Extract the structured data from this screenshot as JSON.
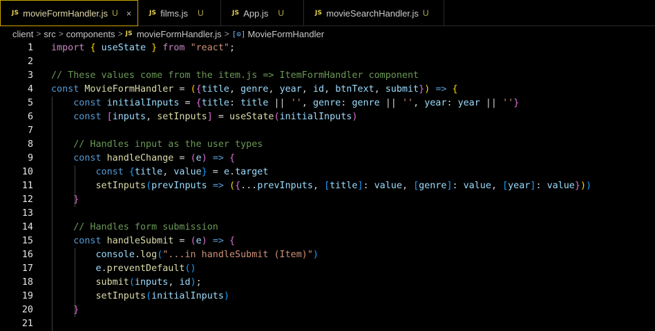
{
  "tabs": [
    {
      "icon": "JS",
      "label": "movieFormHandler.js",
      "status": "U",
      "close": "×",
      "active": true
    },
    {
      "icon": "JS",
      "label": "films.js",
      "status": "U",
      "active": false
    },
    {
      "icon": "JS",
      "label": "App.js",
      "status": "U",
      "active": false
    },
    {
      "icon": "JS",
      "label": "movieSearchHandler.js",
      "status": "U",
      "active": false
    }
  ],
  "breadcrumb": {
    "items": [
      "client",
      "src",
      "components"
    ],
    "file_icon": "JS",
    "file": "movieFormHandler.js",
    "symbol": "MovieFormHandler",
    "sep": ">"
  },
  "editor": {
    "line_numbers": [
      "1",
      "2",
      "3",
      "4",
      "5",
      "6",
      "7",
      "8",
      "9",
      "10",
      "11",
      "12",
      "13",
      "14",
      "15",
      "16",
      "17",
      "18",
      "19",
      "20",
      "21"
    ],
    "lines": [
      [
        [
          "ctl",
          "import"
        ],
        [
          "op",
          " "
        ],
        [
          "b1",
          "{"
        ],
        [
          "op",
          " "
        ],
        [
          "var",
          "useState"
        ],
        [
          "op",
          " "
        ],
        [
          "b1",
          "}"
        ],
        [
          "op",
          " "
        ],
        [
          "ctl",
          "from"
        ],
        [
          "op",
          " "
        ],
        [
          "str",
          "\"react\""
        ],
        [
          "op",
          ";"
        ]
      ],
      [],
      [
        [
          "cmt",
          "// These values come from the item.js => ItemFormHandler component"
        ]
      ],
      [
        [
          "kw",
          "const"
        ],
        [
          "op",
          " "
        ],
        [
          "fn",
          "MovieFormHandler"
        ],
        [
          "op",
          " = "
        ],
        [
          "b1",
          "("
        ],
        [
          "b2",
          "{"
        ],
        [
          "var",
          "title"
        ],
        [
          "op",
          ", "
        ],
        [
          "var",
          "genre"
        ],
        [
          "op",
          ", "
        ],
        [
          "var",
          "year"
        ],
        [
          "op",
          ", "
        ],
        [
          "var",
          "id"
        ],
        [
          "op",
          ", "
        ],
        [
          "var",
          "btnText"
        ],
        [
          "op",
          ", "
        ],
        [
          "var",
          "submit"
        ],
        [
          "b2",
          "}"
        ],
        [
          "b1",
          ")"
        ],
        [
          "op",
          " "
        ],
        [
          "kw",
          "=>"
        ],
        [
          "op",
          " "
        ],
        [
          "b1",
          "{"
        ]
      ],
      [
        [
          "op",
          "    "
        ],
        [
          "kw",
          "const"
        ],
        [
          "op",
          " "
        ],
        [
          "var",
          "initialInputs"
        ],
        [
          "op",
          " = "
        ],
        [
          "b2",
          "{"
        ],
        [
          "var",
          "title"
        ],
        [
          "op",
          ": "
        ],
        [
          "var",
          "title"
        ],
        [
          "op",
          " || "
        ],
        [
          "str",
          "''"
        ],
        [
          "op",
          ", "
        ],
        [
          "var",
          "genre"
        ],
        [
          "op",
          ": "
        ],
        [
          "var",
          "genre"
        ],
        [
          "op",
          " || "
        ],
        [
          "str",
          "''"
        ],
        [
          "op",
          ", "
        ],
        [
          "var",
          "year"
        ],
        [
          "op",
          ": "
        ],
        [
          "var",
          "year"
        ],
        [
          "op",
          " || "
        ],
        [
          "str",
          "''"
        ],
        [
          "b2",
          "}"
        ]
      ],
      [
        [
          "op",
          "    "
        ],
        [
          "kw",
          "const"
        ],
        [
          "op",
          " "
        ],
        [
          "b2",
          "["
        ],
        [
          "var",
          "inputs"
        ],
        [
          "op",
          ", "
        ],
        [
          "fn",
          "setInputs"
        ],
        [
          "b2",
          "]"
        ],
        [
          "op",
          " = "
        ],
        [
          "fn",
          "useState"
        ],
        [
          "b2",
          "("
        ],
        [
          "var",
          "initialInputs"
        ],
        [
          "b2",
          ")"
        ]
      ],
      [],
      [
        [
          "op",
          "    "
        ],
        [
          "cmt",
          "// Handles input as the user types"
        ]
      ],
      [
        [
          "op",
          "    "
        ],
        [
          "kw",
          "const"
        ],
        [
          "op",
          " "
        ],
        [
          "fn",
          "handleChange"
        ],
        [
          "op",
          " = "
        ],
        [
          "b2",
          "("
        ],
        [
          "var",
          "e"
        ],
        [
          "b2",
          ")"
        ],
        [
          "op",
          " "
        ],
        [
          "kw",
          "=>"
        ],
        [
          "op",
          " "
        ],
        [
          "b2",
          "{"
        ]
      ],
      [
        [
          "op",
          "        "
        ],
        [
          "kw",
          "const"
        ],
        [
          "op",
          " "
        ],
        [
          "b3",
          "{"
        ],
        [
          "var",
          "title"
        ],
        [
          "op",
          ", "
        ],
        [
          "var",
          "value"
        ],
        [
          "b3",
          "}"
        ],
        [
          "op",
          " = "
        ],
        [
          "var",
          "e"
        ],
        [
          "op",
          "."
        ],
        [
          "var",
          "target"
        ]
      ],
      [
        [
          "op",
          "        "
        ],
        [
          "fn",
          "setInputs"
        ],
        [
          "b3",
          "("
        ],
        [
          "var",
          "prevInputs"
        ],
        [
          "op",
          " "
        ],
        [
          "kw",
          "=>"
        ],
        [
          "op",
          " "
        ],
        [
          "b1",
          "("
        ],
        [
          "b2",
          "{"
        ],
        [
          "op",
          "..."
        ],
        [
          "var",
          "prevInputs"
        ],
        [
          "op",
          ", "
        ],
        [
          "b3",
          "["
        ],
        [
          "var",
          "title"
        ],
        [
          "b3",
          "]"
        ],
        [
          "op",
          ": "
        ],
        [
          "var",
          "value"
        ],
        [
          "op",
          ", "
        ],
        [
          "b3",
          "["
        ],
        [
          "var",
          "genre"
        ],
        [
          "b3",
          "]"
        ],
        [
          "op",
          ": "
        ],
        [
          "var",
          "value"
        ],
        [
          "op",
          ", "
        ],
        [
          "b3",
          "["
        ],
        [
          "var",
          "year"
        ],
        [
          "b3",
          "]"
        ],
        [
          "op",
          ": "
        ],
        [
          "var",
          "value"
        ],
        [
          "b2",
          "}"
        ],
        [
          "b1",
          ")"
        ],
        [
          "b3",
          ")"
        ]
      ],
      [
        [
          "op",
          "    "
        ],
        [
          "b2",
          "}"
        ]
      ],
      [],
      [
        [
          "op",
          "    "
        ],
        [
          "cmt",
          "// Handles form submission"
        ]
      ],
      [
        [
          "op",
          "    "
        ],
        [
          "kw",
          "const"
        ],
        [
          "op",
          " "
        ],
        [
          "fn",
          "handleSubmit"
        ],
        [
          "op",
          " = "
        ],
        [
          "b2",
          "("
        ],
        [
          "var",
          "e"
        ],
        [
          "b2",
          ")"
        ],
        [
          "op",
          " "
        ],
        [
          "kw",
          "=>"
        ],
        [
          "op",
          " "
        ],
        [
          "b2",
          "{"
        ]
      ],
      [
        [
          "op",
          "        "
        ],
        [
          "var",
          "console"
        ],
        [
          "op",
          "."
        ],
        [
          "fn",
          "log"
        ],
        [
          "b3",
          "("
        ],
        [
          "str",
          "\"...in handleSubmit (Item)\""
        ],
        [
          "b3",
          ")"
        ]
      ],
      [
        [
          "op",
          "        "
        ],
        [
          "var",
          "e"
        ],
        [
          "op",
          "."
        ],
        [
          "fn",
          "preventDefault"
        ],
        [
          "b3",
          "()"
        ]
      ],
      [
        [
          "op",
          "        "
        ],
        [
          "fn",
          "submit"
        ],
        [
          "b3",
          "("
        ],
        [
          "var",
          "inputs"
        ],
        [
          "op",
          ", "
        ],
        [
          "var",
          "id"
        ],
        [
          "b3",
          ")"
        ],
        [
          "op",
          ";"
        ]
      ],
      [
        [
          "op",
          "        "
        ],
        [
          "fn",
          "setInputs"
        ],
        [
          "b3",
          "("
        ],
        [
          "var",
          "initialInputs"
        ],
        [
          "b3",
          ")"
        ]
      ],
      [
        [
          "op",
          "    "
        ],
        [
          "b2",
          "}"
        ]
      ],
      []
    ]
  }
}
